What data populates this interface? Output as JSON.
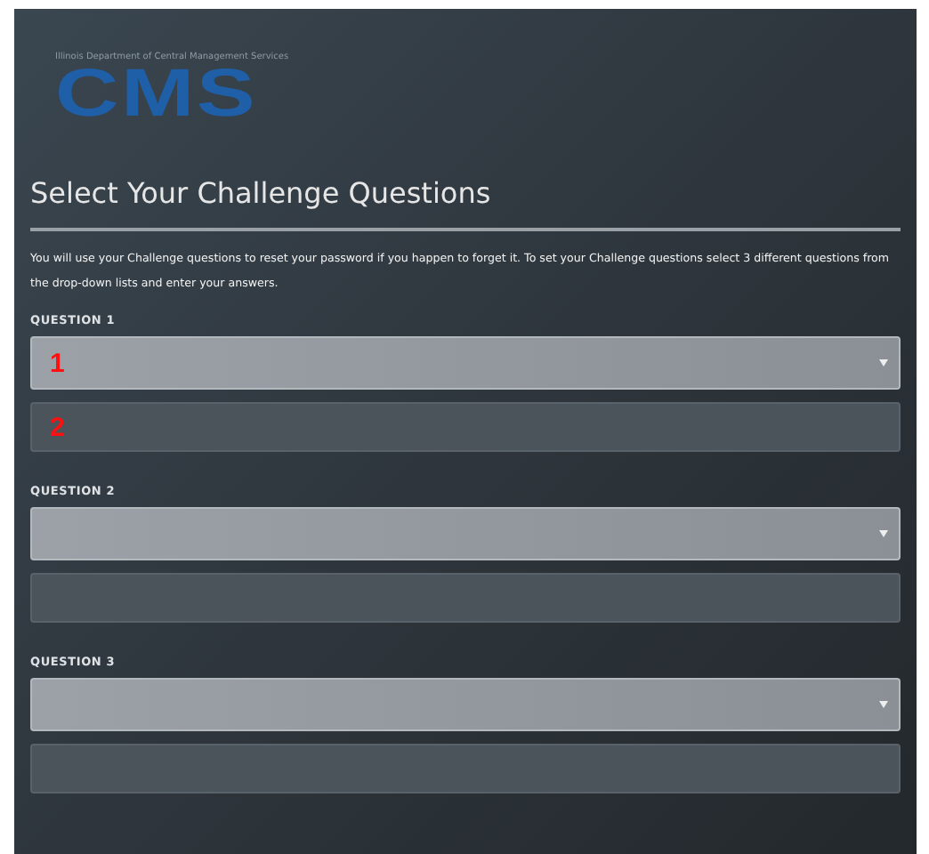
{
  "header": {
    "agency": "Illinois Department of Central Management Services",
    "logo": "CMS"
  },
  "title": "Select Your Challenge Questions",
  "intro": "You will use your Challenge questions to reset your password if you happen to forget it. To set your Challenge questions select 3 different questions from the drop-down lists and enter your answers.",
  "questions": [
    {
      "label": "QUESTION 1",
      "select_marker": "1",
      "answer_marker": "2"
    },
    {
      "label": "QUESTION 2"
    },
    {
      "label": "QUESTION 3"
    }
  ]
}
